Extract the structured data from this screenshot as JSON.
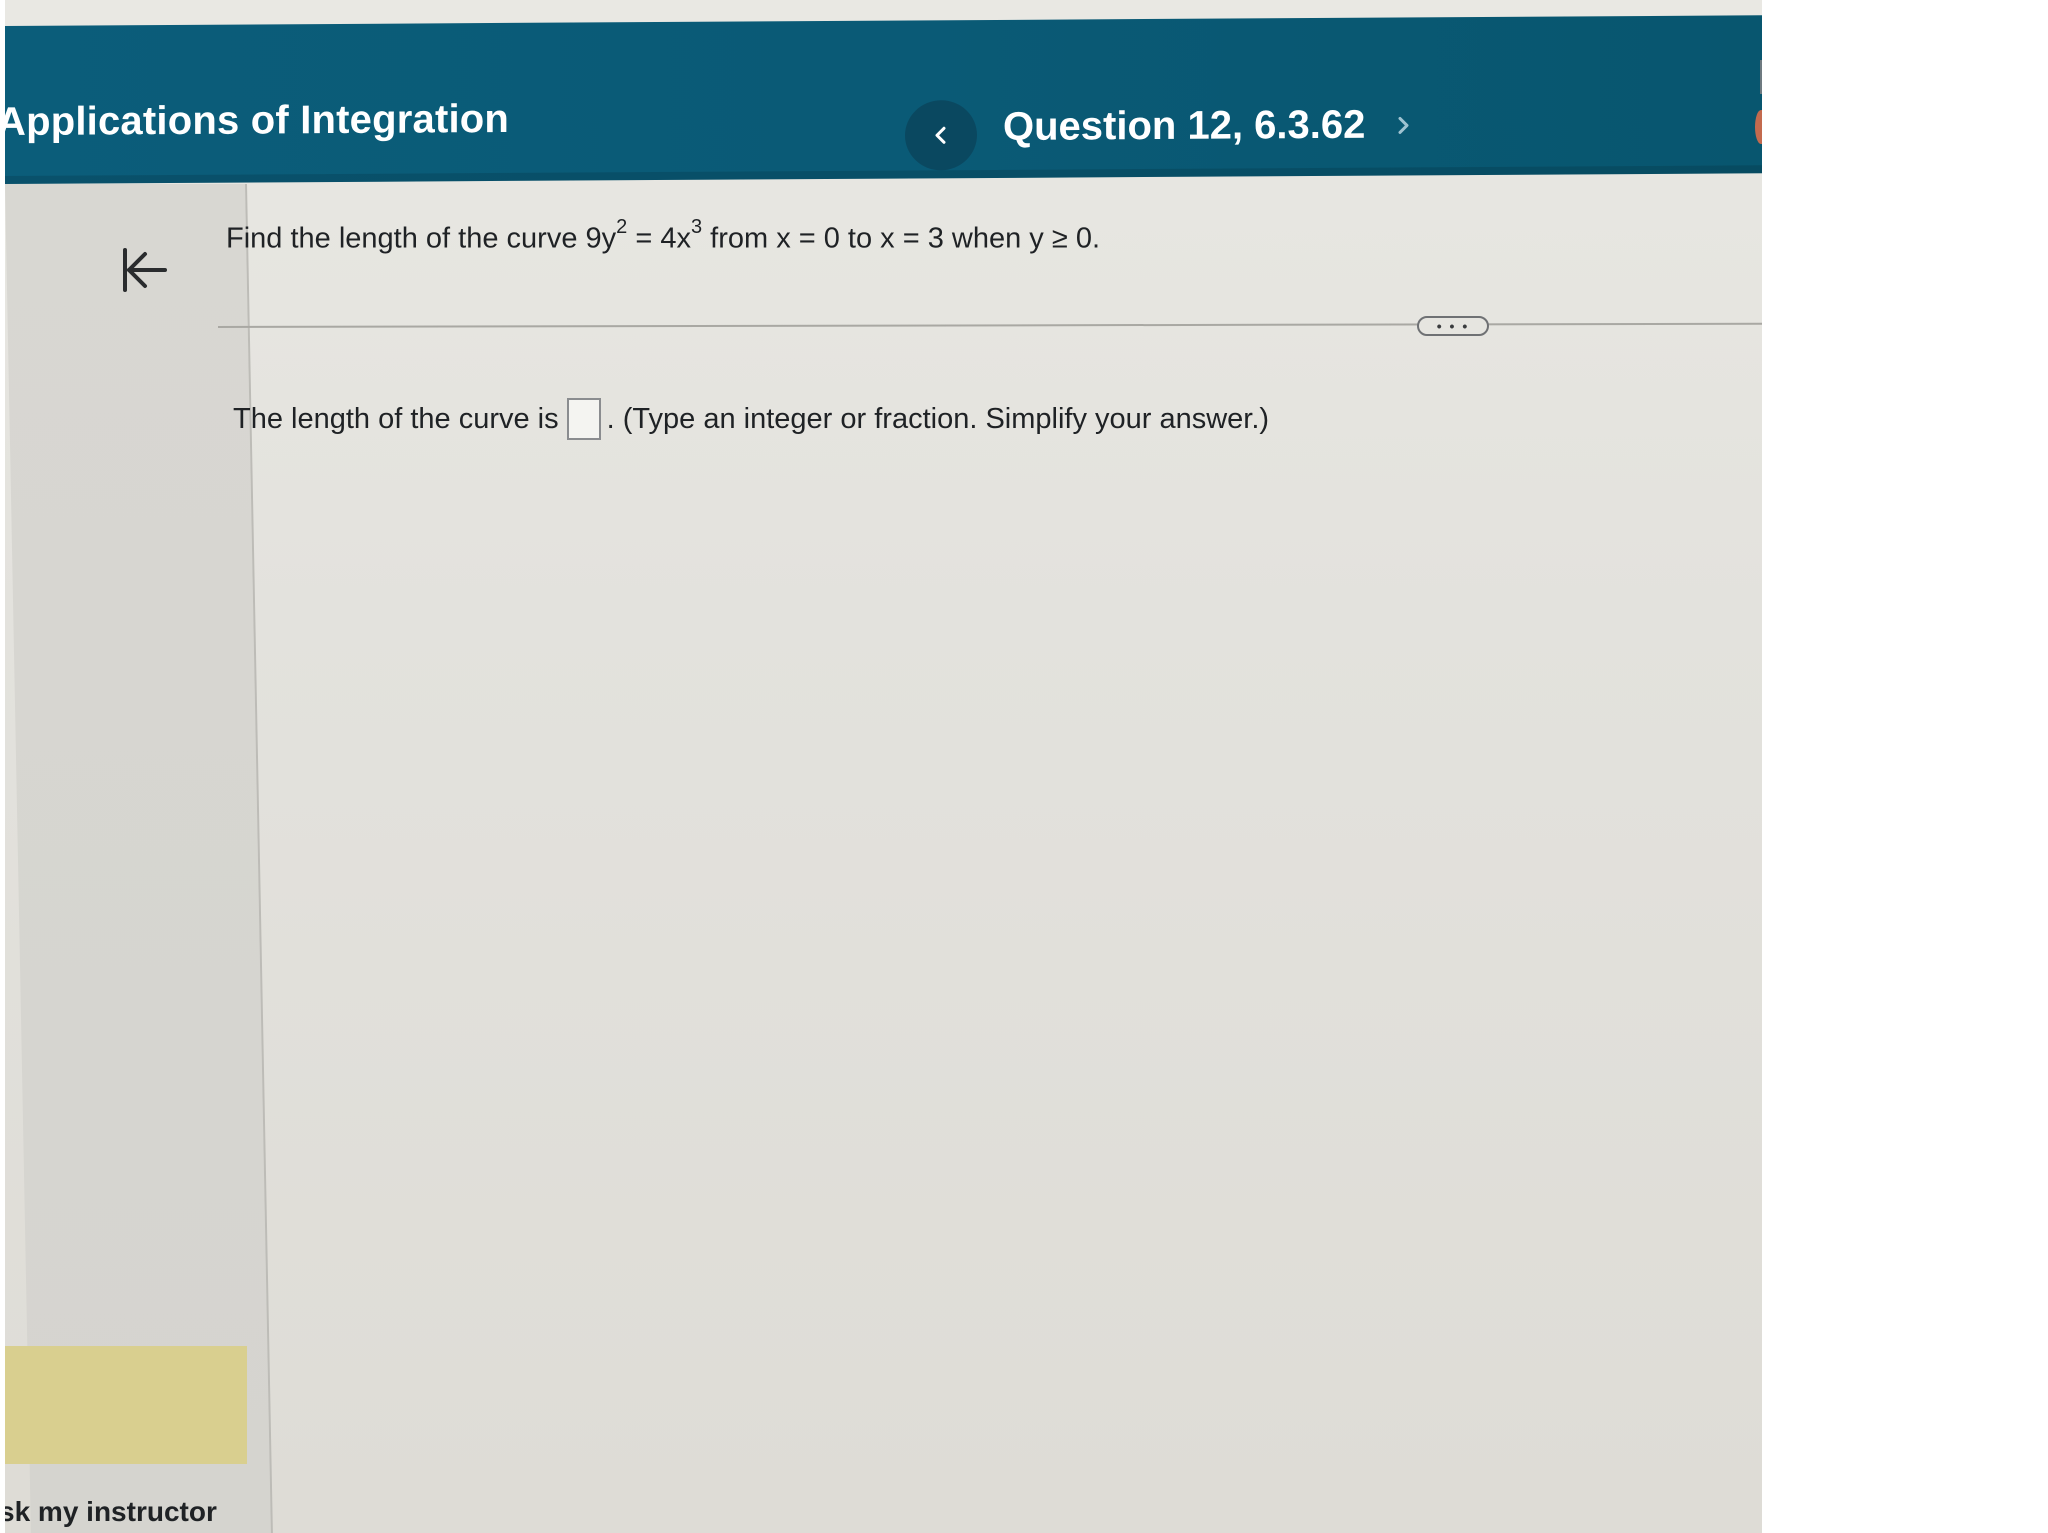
{
  "header": {
    "title": "Applications of Integration",
    "question_label": "Question 12, 6.3.62"
  },
  "question": {
    "prefix": "Find the length of the curve 9y",
    "exp1": "2",
    "mid": " = 4x",
    "exp2": "3",
    "suffix": " from x = 0 to x = 3 when y ≥ 0."
  },
  "answer": {
    "lead": "The length of the curve is",
    "tail": ". (Type an integer or fraction. Simplify your answer.)",
    "value": ""
  },
  "more_button": {
    "label": "• • •"
  },
  "sidebar": {
    "ask_instructor": "sk my instructor"
  },
  "icons": {
    "prev": "chevron-left-icon",
    "next": "chevron-right-icon",
    "collapse": "collapse-left-icon"
  },
  "colors": {
    "header": "#0b5d7a",
    "highlight": "#d9cf8f"
  }
}
